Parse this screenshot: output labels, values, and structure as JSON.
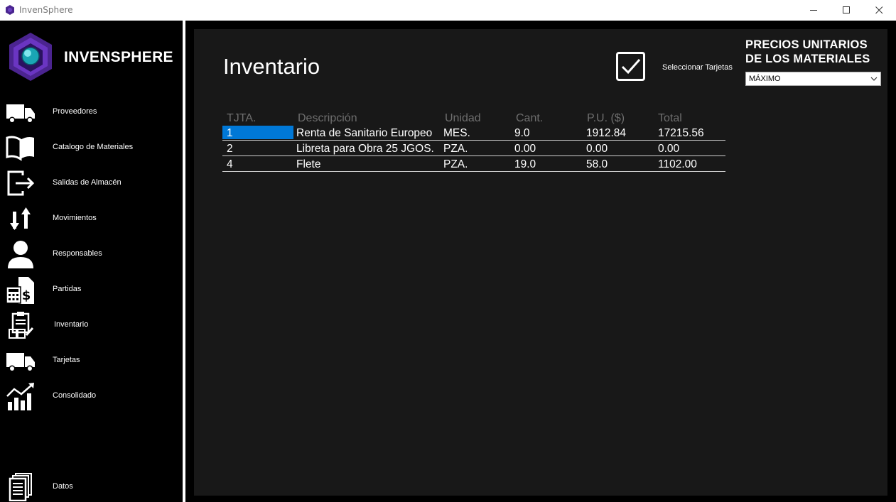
{
  "window": {
    "title": "InvenSphere",
    "app_icon": "hexagon-logo-icon",
    "controls": [
      "minimize-icon",
      "maximize-icon",
      "close-icon"
    ]
  },
  "sidebar": {
    "brand": "INVENSPHERE",
    "items": [
      {
        "label": "Proveedores",
        "icon": "truck-icon"
      },
      {
        "label": "Catalogo de Materiales",
        "icon": "book-icon"
      },
      {
        "label": "Salidas de Almacén",
        "icon": "exit-icon"
      },
      {
        "label": "Movimientos",
        "icon": "up-down-arrows-icon"
      },
      {
        "label": "Responsables",
        "icon": "person-icon"
      },
      {
        "label": "Partidas",
        "icon": "calculator-dollar-icon"
      },
      {
        "label": "Inventario",
        "icon": "clipboard-boxes-icon"
      },
      {
        "label": "Tarjetas",
        "icon": "truck-icon"
      },
      {
        "label": "Consolidado",
        "icon": "bar-chart-trend-icon"
      },
      {
        "label": "Datos",
        "icon": "documents-icon"
      }
    ]
  },
  "main": {
    "title": "Inventario",
    "select_cards_label": "Seleccionar Tarjetas",
    "select_cards_checked": true,
    "prices_heading_line1": "PRECIOS UNITARIOS",
    "prices_heading_line2": "DE LOS MATERIALES",
    "prices_selected": "MÁXIMO"
  },
  "table": {
    "headers": [
      "TJTA.",
      "Descripción",
      "Unidad",
      "Cant.",
      "P.U. ($)",
      "Total"
    ],
    "rows": [
      [
        "1",
        "Renta de Sanitario Europeo",
        "MES.",
        "9.0",
        "1912.84",
        "17215.56"
      ],
      [
        "2",
        "Libreta para Obra 25 JGOS.",
        "PZA.",
        "0.00",
        "0.00",
        "0.00"
      ],
      [
        "4",
        "Flete",
        "PZA.",
        "19.0",
        "58.0",
        "1102.00"
      ]
    ],
    "selected_row": 0
  },
  "colors": {
    "sidebar_bg": "#000000",
    "panel_bg": "#181818",
    "accent_selection": "#0078d7",
    "header_text": "#6e6e6e",
    "logo_purple": "#5b2d9e",
    "logo_teal": "#1aa5b5"
  }
}
